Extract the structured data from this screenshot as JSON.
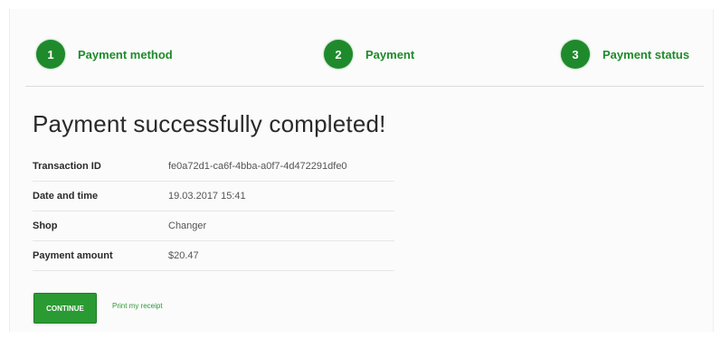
{
  "steps": [
    {
      "number": "1",
      "label": "Payment method"
    },
    {
      "number": "2",
      "label": "Payment"
    },
    {
      "number": "3",
      "label": "Payment status"
    }
  ],
  "title": "Payment successfully completed!",
  "details": [
    {
      "key": "Transaction ID",
      "value": "fe0a72d1-ca6f-4bba-a0f7-4d472291dfe0"
    },
    {
      "key": "Date and time",
      "value": "19.03.2017 15:41"
    },
    {
      "key": "Shop",
      "value": "Changer"
    },
    {
      "key": "Payment amount",
      "value": "$20.47"
    }
  ],
  "actions": {
    "continue_label": "CONTINUE",
    "print_label": "Print my receipt"
  },
  "colors": {
    "accent": "#1f8a2b",
    "button": "#2a9a33"
  }
}
